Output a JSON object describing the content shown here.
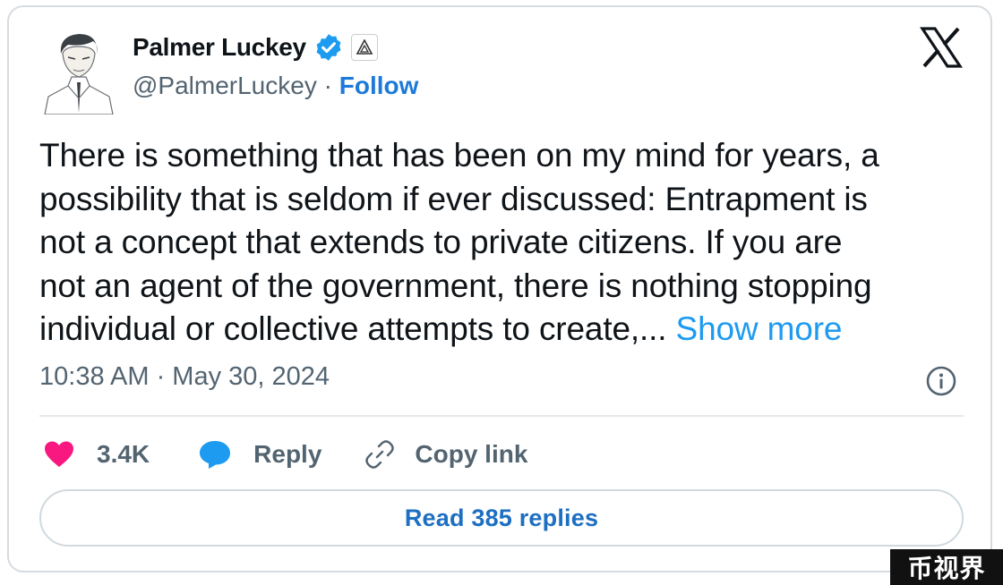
{
  "author": {
    "name": "Palmer Luckey",
    "handle": "@PalmerLuckey",
    "separator": " · ",
    "follow_label": "Follow",
    "avatar_icon": "anime-portrait-avatar",
    "verified_icon": "verified-badge-icon",
    "affiliation_icon": "affiliate-logo-icon"
  },
  "tweet": {
    "lines": [
      "There is something that has been on my mind for years, a",
      "possibility that is seldom if ever discussed: Entrapment is",
      "not a concept that extends to private citizens.  If you are",
      "not an agent of the government, there is nothing stopping",
      "individual or collective attempts to create,..."
    ],
    "show_more": "Show more",
    "timestamp": "10:38 AM · May 30, 2024"
  },
  "actions": {
    "like_count": "3.4K",
    "reply_label": "Reply",
    "copy_link_label": "Copy link"
  },
  "read_replies_label": "Read 385 replies",
  "watermark": "币视界",
  "colors": {
    "link_blue": "#1d9bf0",
    "follow_blue": "#1d7ad8",
    "heart_pink": "#f91880",
    "reply_blue": "#1d9bf0",
    "muted_gray": "#536471"
  }
}
